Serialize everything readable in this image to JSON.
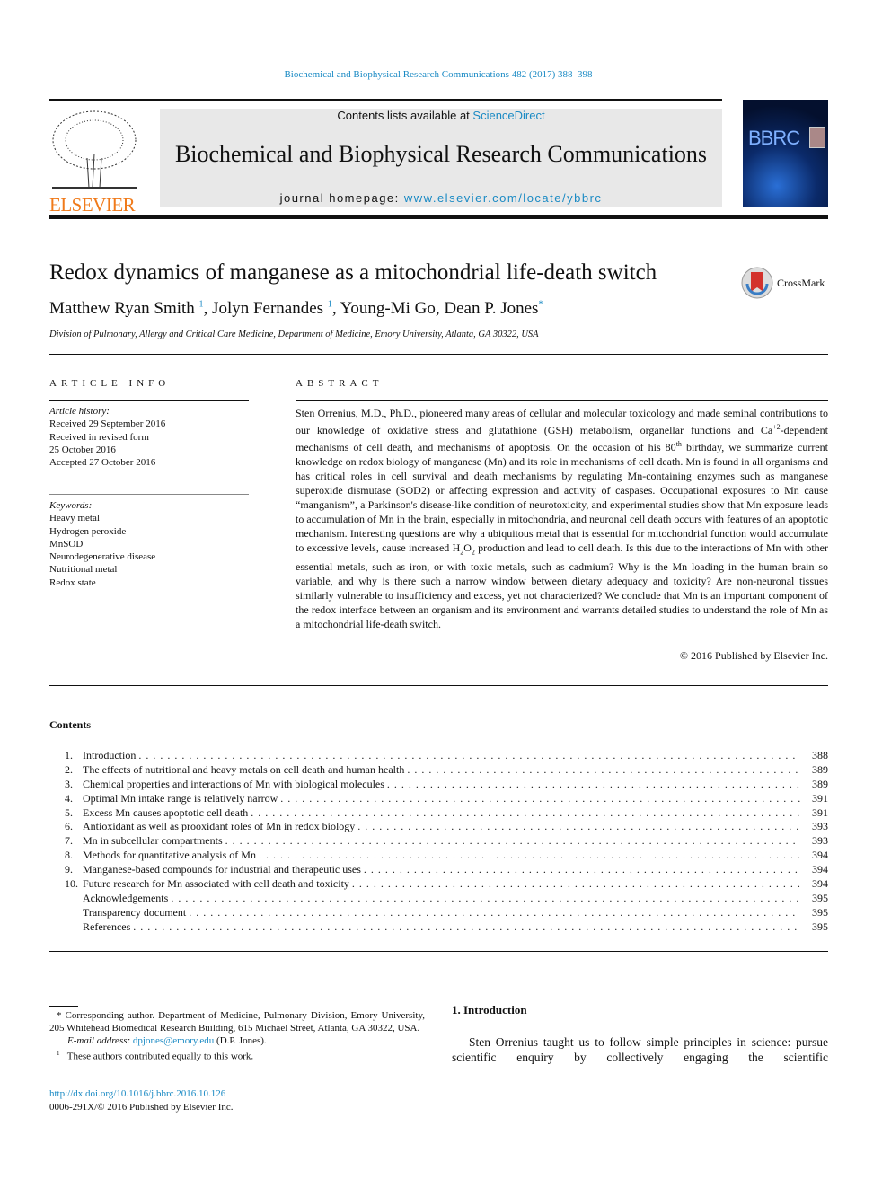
{
  "citation": "Biochemical and Biophysical Research Communications 482 (2017) 388–398",
  "header": {
    "contents_prefix": "Contents lists available at ",
    "sciencedirect": "ScienceDirect",
    "journal_title": "Biochemical and Biophysical Research Communications",
    "homepage_prefix": "journal homepage: ",
    "homepage_url": "www.elsevier.com/locate/ybbrc",
    "publisher_logo": "ELSEVIER",
    "cover_text": "BBRC"
  },
  "crossmark": "CrossMark",
  "article": {
    "title": "Redox dynamics of manganese as a mitochondrial life-death switch",
    "authors": [
      {
        "name": "Matthew Ryan Smith",
        "mark": "1"
      },
      {
        "name": "Jolyn Fernandes",
        "mark": "1"
      },
      {
        "name": "Young-Mi Go"
      },
      {
        "name": "Dean P. Jones",
        "mark": "*"
      }
    ],
    "affiliation": "Division of Pulmonary, Allergy and Critical Care Medicine, Department of Medicine, Emory University, Atlanta, GA 30322, USA"
  },
  "article_info": {
    "heading": "ARTICLE INFO",
    "history_label": "Article history:",
    "history": [
      "Received 29 September 2016",
      "Received in revised form",
      "25 October 2016",
      "Accepted 27 October 2016"
    ],
    "keywords_label": "Keywords:",
    "keywords": [
      "Heavy metal",
      "Hydrogen peroxide",
      "MnSOD",
      "Neurodegenerative disease",
      "Nutritional metal",
      "Redox state"
    ]
  },
  "abstract": {
    "heading": "ABSTRACT",
    "p1": "Sten Orrenius, M.D., Ph.D., pioneered many areas of cellular and molecular toxicology and made seminal contributions to our knowledge of oxidative stress and glutathione (GSH) metabolism, organellar functions and Ca",
    "sup1": "+2",
    "p2": "-dependent mechanisms of cell death, and mechanisms of apoptosis. On the occasion of his 80",
    "sup2": "th",
    "p3": " birthday, we summarize current knowledge on redox biology of manganese (Mn) and its role in mechanisms of cell death. Mn is found in all organisms and has critical roles in cell survival and death mechanisms by regulating Mn-containing enzymes such as manganese superoxide dismutase (SOD2) or affecting expression and activity of caspases. Occupational exposures to Mn cause “manganism”, a Parkinson's disease-like condition of neurotoxicity, and experimental studies show that Mn exposure leads to accumulation of Mn in the brain, especially in mitochondria, and neuronal cell death occurs with features of an apoptotic mechanism. Interesting questions are why a ubiquitous metal that is essential for mitochondrial function would accumulate to excessive levels, cause increased H",
    "sub1": "2",
    "p4": "O",
    "sub2": "2",
    "p5": " production and lead to cell death. Is this due to the interactions of Mn with other essential metals, such as iron, or with toxic metals, such as cadmium? Why is the Mn loading in the human brain so variable, and why is there such a narrow window between dietary adequacy and toxicity? Are non-neuronal tissues similarly vulnerable to insufficiency and excess, yet not characterized? We conclude that Mn is an important component of the redox interface between an organism and its environment and warrants detailed studies to understand the role of Mn as a mitochondrial life-death switch.",
    "copyright": "© 2016 Published by Elsevier Inc."
  },
  "contents": {
    "heading": "Contents",
    "entries": [
      {
        "num": "1.",
        "title": "Introduction",
        "page": "388"
      },
      {
        "num": "2.",
        "title": "The effects of nutritional and heavy metals on cell death and human health",
        "page": "389"
      },
      {
        "num": "3.",
        "title": "Chemical properties and interactions of Mn with biological molecules",
        "page": "389"
      },
      {
        "num": "4.",
        "title": "Optimal Mn intake range is relatively narrow",
        "page": "391"
      },
      {
        "num": "5.",
        "title": "Excess Mn causes apoptotic cell death",
        "page": "391"
      },
      {
        "num": "6.",
        "title": "Antioxidant as well as prooxidant roles of Mn in redox biology",
        "page": "393"
      },
      {
        "num": "7.",
        "title": "Mn in subcellular compartments",
        "page": "393"
      },
      {
        "num": "8.",
        "title": "Methods for quantitative analysis of Mn",
        "page": "394"
      },
      {
        "num": "9.",
        "title": "Manganese-based compounds for industrial and therapeutic uses",
        "page": "394"
      },
      {
        "num": "10.",
        "title": "Future research for Mn associated with cell death and toxicity",
        "page": "394"
      },
      {
        "num": "",
        "title": "Acknowledgements",
        "page": "395"
      },
      {
        "num": "",
        "title": "Transparency document",
        "page": "395"
      },
      {
        "num": "",
        "title": "References",
        "page": "395"
      }
    ]
  },
  "footnotes": {
    "corresponding": "* Corresponding author. Department of Medicine, Pulmonary Division, Emory University, 205 Whitehead Biomedical Research Building, 615 Michael Street, Atlanta, GA 30322, USA.",
    "email_label": "E-mail address: ",
    "email": "dpjones@emory.edu",
    "email_suffix": " (D.P. Jones).",
    "equal": "These authors contributed equally to this work.",
    "equal_mark": "1",
    "doi": "http://dx.doi.org/10.1016/j.bbrc.2016.10.126",
    "issn": "0006-291X/© 2016 Published by Elsevier Inc."
  },
  "intro": {
    "heading": "1.  Introduction",
    "text": "Sten Orrenius taught us to follow simple principles in science: pursue scientific enquiry by collectively engaging the scientific"
  },
  "colors": {
    "link": "#1a8ac4",
    "elsevier_orange": "#f07a1a"
  }
}
